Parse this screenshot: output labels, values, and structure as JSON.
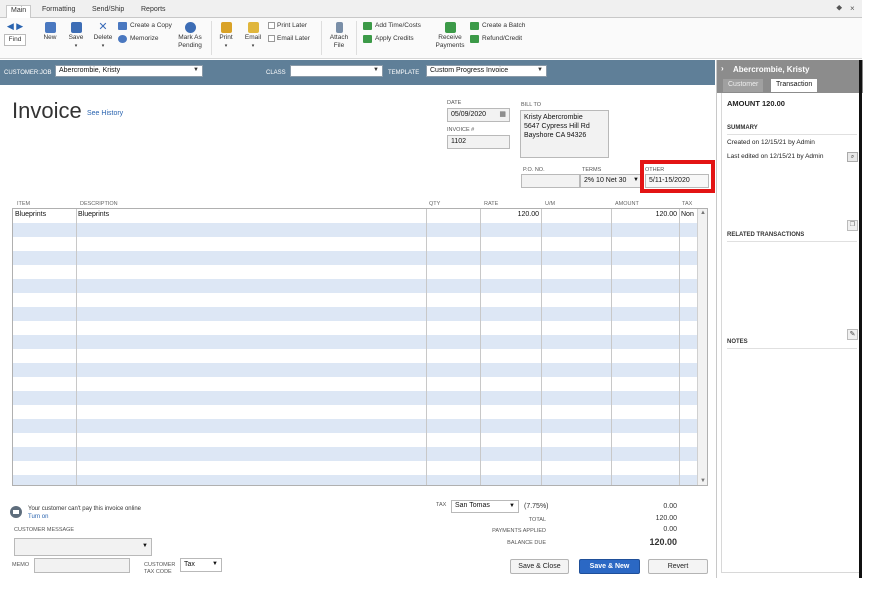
{
  "ribbon": {
    "tabs": [
      "Main",
      "Formatting",
      "Send/Ship",
      "Reports"
    ],
    "active_tab": "Main",
    "window_controls": [
      "⯁",
      "×"
    ]
  },
  "toolbar": {
    "find": "Find",
    "new": "New",
    "save": "Save",
    "delete": "Delete",
    "create_copy": "Create a Copy",
    "memorize": "Memorize",
    "mark_as_pending_1": "Mark As",
    "mark_as_pending_2": "Pending",
    "print": "Print",
    "email": "Email",
    "print_later": "Print Later",
    "email_later": "Email Later",
    "attach_file_1": "Attach",
    "attach_file_2": "File",
    "add_time_costs": "Add Time/Costs",
    "apply_credits": "Apply Credits",
    "receive_payments_1": "Receive",
    "receive_payments_2": "Payments",
    "create_batch": "Create a Batch",
    "refund_credit": "Refund/Credit"
  },
  "custbar": {
    "customer_job_label": "CUSTOMER:JOB",
    "customer_job_value": "Abercrombie, Kristy",
    "class_label": "CLASS",
    "class_value": "",
    "template_label": "TEMPLATE",
    "template_value": "Custom Progress Invoice"
  },
  "form": {
    "title": "Invoice",
    "see_history": "See History",
    "date_label": "DATE",
    "date_value": "05/09/2020",
    "invoice_no_label": "INVOICE #",
    "invoice_no_value": "1102",
    "bill_to_label": "BILL TO",
    "bill_to_lines": [
      "Kristy Abercrombie",
      "5647 Cypress Hill Rd",
      "Bayshore CA 94326"
    ],
    "po_label": "P.O. NO.",
    "po_value": "",
    "terms_label": "TERMS",
    "terms_value": "2% 10 Net 30",
    "other_label": "OTHER",
    "other_value": "5/11-15/2020"
  },
  "table": {
    "headers": [
      "ITEM",
      "DESCRIPTION",
      "QTY",
      "RATE",
      "U/M",
      "AMOUNT",
      "TAX"
    ],
    "rows": [
      {
        "item": "Blueprints",
        "description": "Blueprints",
        "qty": "",
        "rate": "120.00",
        "um": "",
        "amount": "120.00",
        "tax": "Non"
      }
    ]
  },
  "footer": {
    "online_pay_notice": "Your customer can't pay this invoice online",
    "turn_on": "Turn on",
    "customer_message_label": "CUSTOMER MESSAGE",
    "memo_label": "MEMO",
    "customer_tax_code_label_1": "CUSTOMER",
    "customer_tax_code_label_2": "TAX CODE",
    "customer_tax_code_value": "Tax",
    "tax_label": "TAX",
    "tax_item": "San Tomas",
    "tax_rate": "(7.75%)",
    "tax_amount": "0.00",
    "total_label": "TOTAL",
    "total_value": "120.00",
    "payments_applied_label": "PAYMENTS APPLIED",
    "payments_applied_value": "0.00",
    "balance_due_label": "BALANCE DUE",
    "balance_due_value": "120.00",
    "save_close": "Save & Close",
    "save_new": "Save & New",
    "revert": "Revert"
  },
  "right_panel": {
    "customer_name": "Abercrombie, Kristy",
    "tabs": [
      "Customer",
      "Transaction"
    ],
    "active_tab": "Transaction",
    "amount": "AMOUNT 120.00",
    "summary_label": "SUMMARY",
    "created_on": "Created on 12/15/21  by  Admin",
    "last_edited": "Last edited on 12/15/21  by  Admin",
    "related_label": "RELATED TRANSACTIONS",
    "notes_label": "NOTES"
  },
  "colors": {
    "customer_bar": "#5f7f98",
    "row_stripe": "#dde7f5",
    "highlight": "#e31414",
    "primary_button": "#2b68c4"
  }
}
